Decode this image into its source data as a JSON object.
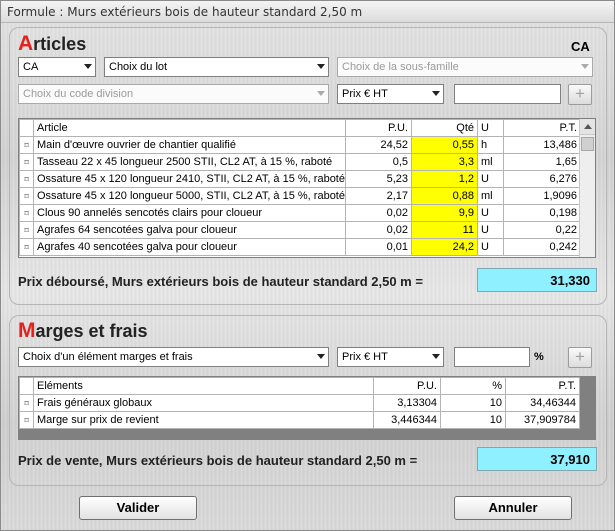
{
  "window": {
    "title": "Formule : Murs extérieurs bois de hauteur standard 2,50 m"
  },
  "articles": {
    "title_first": "A",
    "title_rest": "rticles",
    "ca_label": "CA",
    "ca_select": "CA",
    "lot_select": "Choix du lot",
    "subfamily_select": "Choix de la sous-famille",
    "division_select": "Choix du code division",
    "price_select": "Prix € HT",
    "price_input": "",
    "plus": "+",
    "columns": [
      "Article",
      "P.U.",
      "Qté",
      "U",
      "P.T."
    ],
    "rows": [
      {
        "ind": "⌑",
        "article": "Main d'œuvre ouvrier de chantier qualifié",
        "pu": "24,52",
        "qte": "0,55",
        "u": "h",
        "pt": "13,486"
      },
      {
        "ind": "⌑",
        "article": "Tasseau 22 x 45 longueur 2500 STII, CL2 AT, à 15 %, raboté",
        "pu": "0,5",
        "qte": "3,3",
        "u": "ml",
        "pt": "1,65"
      },
      {
        "ind": "⌑",
        "article": "Ossature 45 x 120 longueur 2410, STII, CL2 AT, à 15 %, raboté",
        "pu": "5,23",
        "qte": "1,2",
        "u": "U",
        "pt": "6,276"
      },
      {
        "ind": "⌑",
        "article": "Ossature 45 x 120 longueur 5000, STII, CL2 AT, à 15 %, raboté",
        "pu": "2,17",
        "qte": "0,88",
        "u": "ml",
        "pt": "1,9096"
      },
      {
        "ind": "⌑",
        "article": "Clous 90 annelés sencotés clairs pour cloueur",
        "pu": "0,02",
        "qte": "9,9",
        "u": "U",
        "pt": "0,198"
      },
      {
        "ind": "⌑",
        "article": "Agrafes 64 sencotées galva pour cloueur",
        "pu": "0,02",
        "qte": "11",
        "u": "U",
        "pt": "0,22"
      },
      {
        "ind": "⌑",
        "article": "Agrafes 40 sencotées galva pour cloueur",
        "pu": "0,01",
        "qte": "24,2",
        "u": "U",
        "pt": "0,242"
      }
    ],
    "total_label": "Prix déboursé, Murs extérieurs bois de hauteur standard 2,50 m  =",
    "total_value": "31,330"
  },
  "marges": {
    "title_first": "M",
    "title_rest": "arges et frais",
    "element_select": "Choix d'un élément marges et frais",
    "price_select": "Prix € HT",
    "percent_input": "",
    "percent_label": "%",
    "plus": "+",
    "columns": [
      "Eléments",
      "P.U.",
      "%",
      "P.T."
    ],
    "rows": [
      {
        "ind": "⌑",
        "element": "Frais généraux globaux",
        "pu": "3,13304",
        "pct": "10",
        "pt": "34,46344"
      },
      {
        "ind": "⌑",
        "element": "Marge sur prix de revient",
        "pu": "3,446344",
        "pct": "10",
        "pt": "37,909784"
      }
    ],
    "total_label": "Prix de vente, Murs extérieurs bois de hauteur standard 2,50 m  =",
    "total_value": "37,910"
  },
  "buttons": {
    "validate": "Valider",
    "cancel": "Annuler"
  },
  "colors": {
    "accent_red": "#e8201a",
    "qty_highlight": "#ffff00",
    "total_bg": "#8ff0ff"
  }
}
